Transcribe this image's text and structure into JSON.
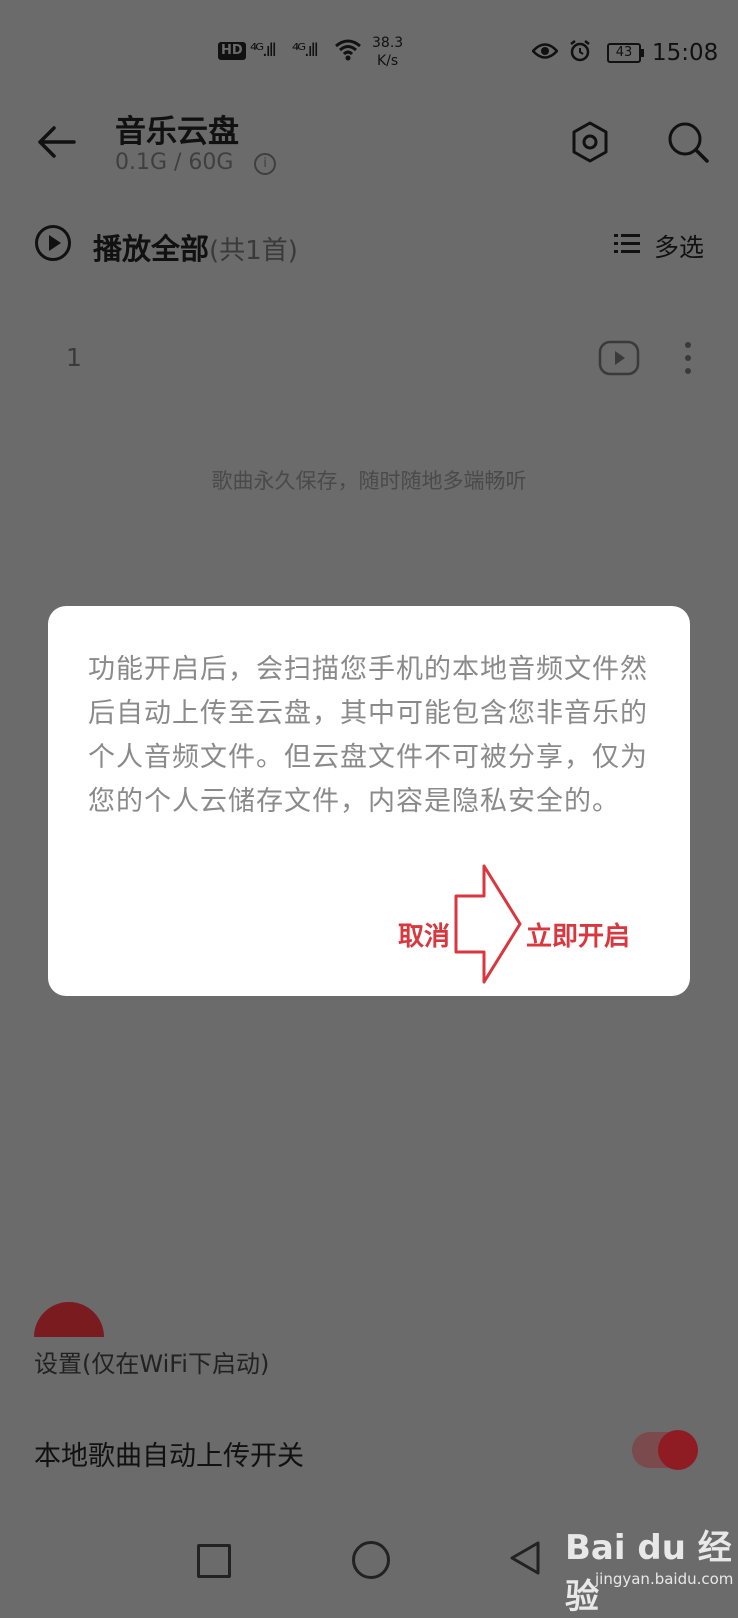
{
  "status_bar": {
    "hd": "HD",
    "signal_1": "⁴ᴳ.ıll",
    "signal_2": "⁴ᴳ.ıll",
    "speed": "38.3",
    "speed_unit": "K/s",
    "battery": "43",
    "time": "15:08"
  },
  "header": {
    "title": "音乐云盘",
    "usage": "0.1G / 60G",
    "info": "i"
  },
  "play_all": {
    "label": "播放全部",
    "count": "(共1首)",
    "multi_select": "多选"
  },
  "song": {
    "index": "1"
  },
  "tagline": "歌曲永久保存，随时随地多端畅听",
  "dialog": {
    "message": "功能开启后，会扫描您手机的本地音频文件然后自动上传至云盘，其中可能包含您非音乐的个人音频文件。但云盘文件不可被分享，仅为您的个人云储存文件，内容是隐私安全的。",
    "cancel": "取消",
    "confirm": "立即开启"
  },
  "bottom_sheet": {
    "settings_label": "设置(仅在WiFi下启动)",
    "upload_toggle_label": "本地歌曲自动上传开关",
    "upload_toggle_on": true
  },
  "watermark": {
    "brand": "Bai du 经验",
    "url": "jingyan.baidu.com"
  },
  "colors": {
    "accent": "#d9363e",
    "overlay": "#6b6b6b"
  }
}
